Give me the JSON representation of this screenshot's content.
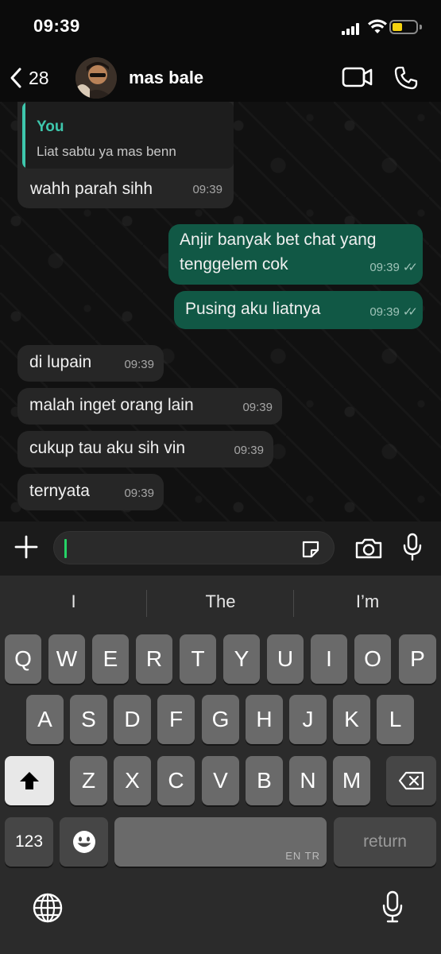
{
  "status_bar": {
    "time": "09:39"
  },
  "header": {
    "back_count": "28",
    "contact_name": "mas bale"
  },
  "messages": [
    {
      "direction": "in",
      "reply": {
        "author": "You",
        "text": "Liat sabtu ya mas benn"
      },
      "text": "wahh parah sihh",
      "time": "09:39"
    },
    {
      "direction": "out",
      "lines": [
        "Anjir banyak bet chat yang",
        "tenggelem cok"
      ],
      "time": "09:39",
      "status": "read"
    },
    {
      "direction": "out",
      "text": "Pusing aku liatnya",
      "time": "09:39",
      "status": "read"
    },
    {
      "direction": "in",
      "text": "di lupain",
      "time": "09:39"
    },
    {
      "direction": "in",
      "text": "malah inget orang lain",
      "time": "09:39"
    },
    {
      "direction": "in",
      "text": "cukup tau aku sih vin",
      "time": "09:39"
    },
    {
      "direction": "in",
      "text": "ternyata",
      "time": "09:39"
    }
  ],
  "input": {
    "value": ""
  },
  "keyboard": {
    "suggestions": [
      "I",
      "The",
      "I’m"
    ],
    "row1": [
      "Q",
      "W",
      "E",
      "R",
      "T",
      "Y",
      "U",
      "I",
      "O",
      "P"
    ],
    "row2": [
      "A",
      "S",
      "D",
      "F",
      "G",
      "H",
      "J",
      "K",
      "L"
    ],
    "row3": [
      "Z",
      "X",
      "C",
      "V",
      "B",
      "N",
      "M"
    ],
    "numbers_label": "123",
    "space_hint": "EN TR",
    "return_label": "return"
  },
  "colors": {
    "outgoing_bubble": "#115845",
    "incoming_bubble": "#262626",
    "quote_accent": "#3ec7ad",
    "battery": "#f5d30f",
    "caret": "#25d366"
  },
  "icons": [
    "back-chevron-icon",
    "video-call-icon",
    "phone-icon",
    "plus-icon",
    "sticker-icon",
    "camera-icon",
    "microphone-icon",
    "shift-icon",
    "backspace-icon",
    "emoji-icon",
    "globe-icon"
  ]
}
